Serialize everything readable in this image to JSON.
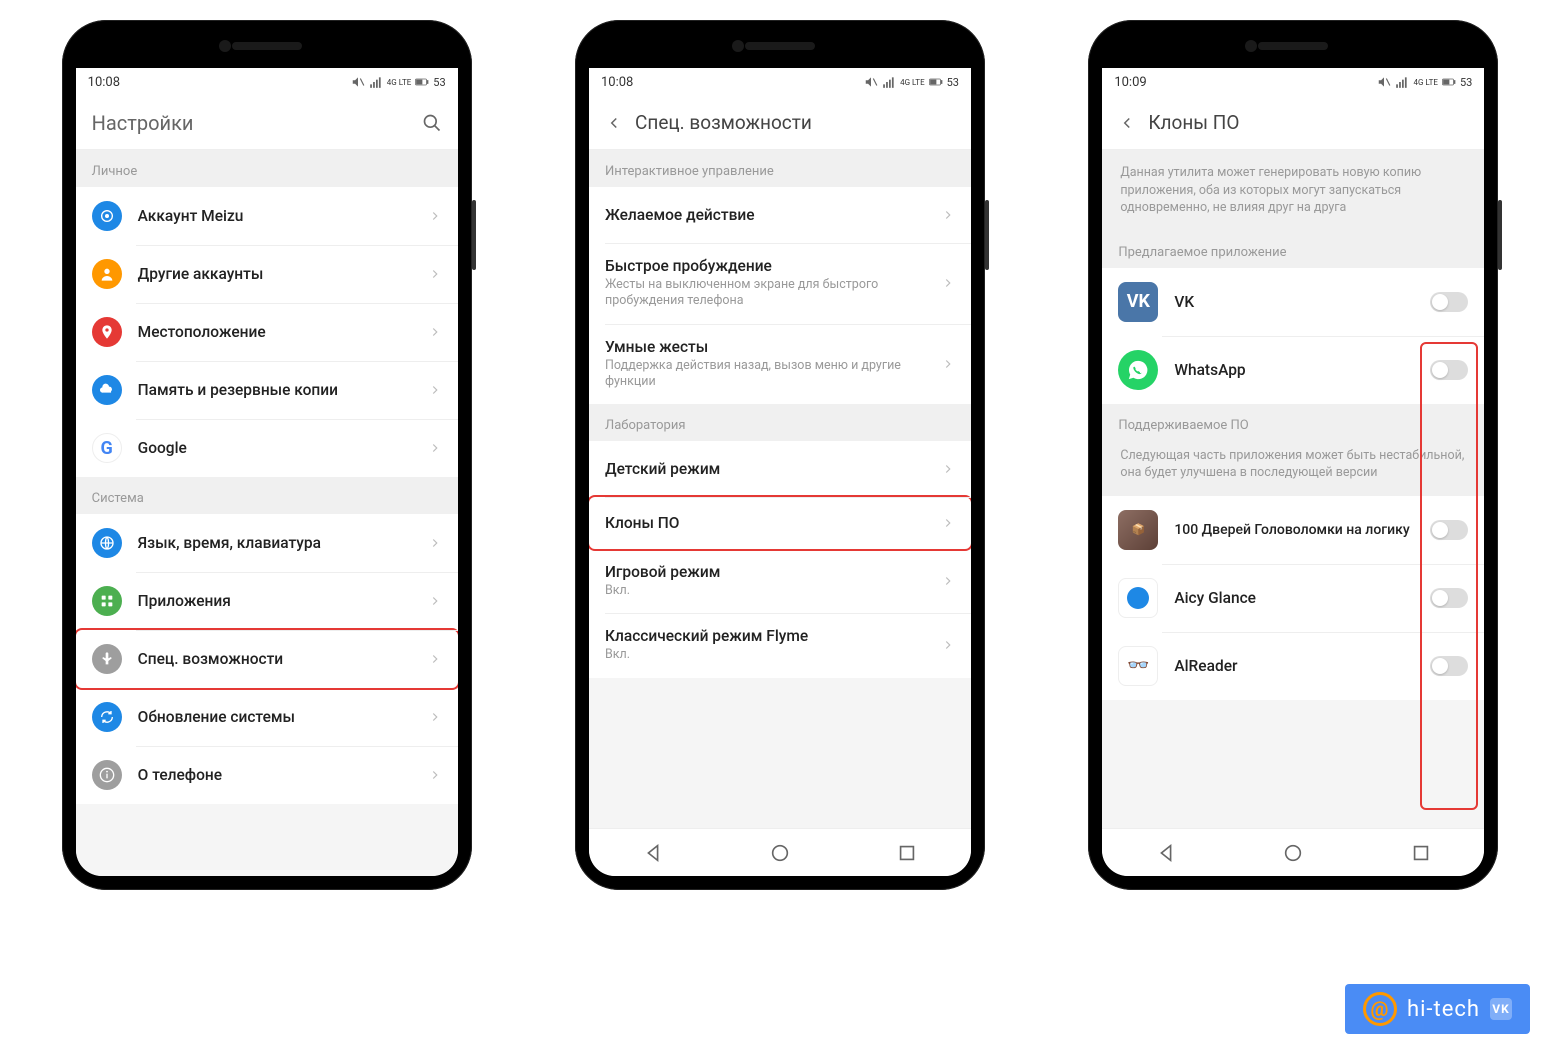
{
  "status": {
    "time1": "10:08",
    "time2": "10:08",
    "time3": "10:09",
    "battery": "53",
    "net": "4G LTE"
  },
  "phone1": {
    "title": "Настройки",
    "section_personal": "Личное",
    "items_personal": [
      {
        "label": "Аккаунт Meizu",
        "icon": "meizu",
        "color": "#1e88e5"
      },
      {
        "label": "Другие аккаунты",
        "icon": "user",
        "color": "#ff9800"
      },
      {
        "label": "Местоположение",
        "icon": "location",
        "color": "#e53935"
      },
      {
        "label": "Память и резервные копии",
        "icon": "cloud",
        "color": "#1e88e5"
      },
      {
        "label": "Google",
        "icon": "google",
        "color": "#1e88e5"
      }
    ],
    "section_system": "Система",
    "items_system": [
      {
        "label": "Язык, время, клавиатура",
        "icon": "globe",
        "color": "#1e88e5"
      },
      {
        "label": "Приложения",
        "icon": "apps",
        "color": "#4caf50"
      },
      {
        "label": "Спец. возможности",
        "icon": "hand",
        "color": "#9e9e9e",
        "highlight": true
      },
      {
        "label": "Обновление системы",
        "icon": "update",
        "color": "#1e88e5"
      },
      {
        "label": "О телефоне",
        "icon": "info",
        "color": "#9e9e9e"
      }
    ]
  },
  "phone2": {
    "title": "Спец. возможности",
    "section1": "Интерактивное управление",
    "items1": [
      {
        "label": "Желаемое действие"
      },
      {
        "label": "Быстрое пробуждение",
        "sub": "Жесты на выключенном экране для быстрого пробуждения телефона"
      },
      {
        "label": "Умные жесты",
        "sub": "Поддержка действия назад, вызов меню и другие функции"
      }
    ],
    "section2": "Лаборатория",
    "items2": [
      {
        "label": "Детский режим"
      },
      {
        "label": "Клоны ПО",
        "highlight": true
      },
      {
        "label": "Игровой режим",
        "sub": "Вкл."
      },
      {
        "label": "Классический режим Flyme",
        "sub": "Вкл."
      }
    ]
  },
  "phone3": {
    "title": "Клоны ПО",
    "desc": "Данная утилита может генерировать новую копию приложения, оба из которых могут запускаться одновременно, не влияя друг на друга",
    "section1": "Предлагаемое приложение",
    "apps1": [
      {
        "label": "VK",
        "bg": "#4a76a8",
        "short": "VK"
      },
      {
        "label": "WhatsApp",
        "bg": "#25d366",
        "short": "wa"
      }
    ],
    "section2": "Поддерживаемое ПО",
    "desc2": "Следующая часть приложения может быть нестабильной, она будет улучшена в последующей версии",
    "apps2": [
      {
        "label": "100 Дверей Головоломки на логику",
        "bg": "#8d6e63",
        "short": "100"
      },
      {
        "label": "Aicy Glance",
        "bg": "#fff",
        "short": "ai"
      },
      {
        "label": "AlReader",
        "bg": "#fff",
        "short": "al"
      }
    ]
  },
  "watermark": {
    "text": "hi-tech",
    "vk": "VK"
  }
}
